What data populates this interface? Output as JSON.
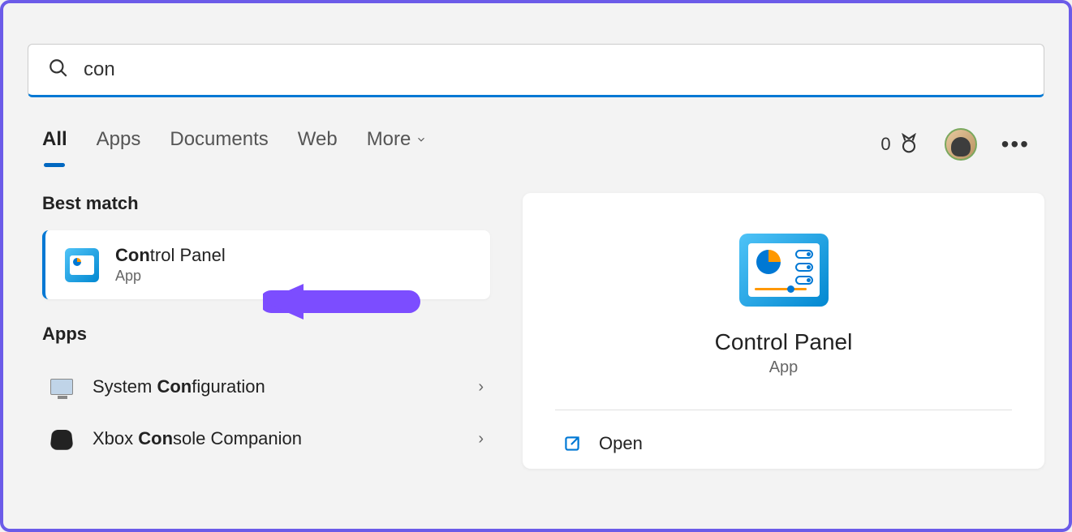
{
  "search": {
    "query": "con"
  },
  "tabs": {
    "items": [
      "All",
      "Apps",
      "Documents",
      "Web",
      "More"
    ],
    "active": "All"
  },
  "rewards": {
    "count": "0"
  },
  "sections": {
    "best_match": {
      "label": "Best match"
    },
    "apps": {
      "label": "Apps"
    }
  },
  "best_match": {
    "title_pre": "Con",
    "title_rest": "trol Panel",
    "subtitle": "App"
  },
  "apps_list": [
    {
      "pre": "System ",
      "bold": "Con",
      "post": "figuration",
      "icon": "monitor"
    },
    {
      "pre": "Xbox ",
      "bold": "Con",
      "post": "sole Companion",
      "icon": "xbox"
    }
  ],
  "detail": {
    "title": "Control Panel",
    "subtitle": "App",
    "open_label": "Open"
  }
}
